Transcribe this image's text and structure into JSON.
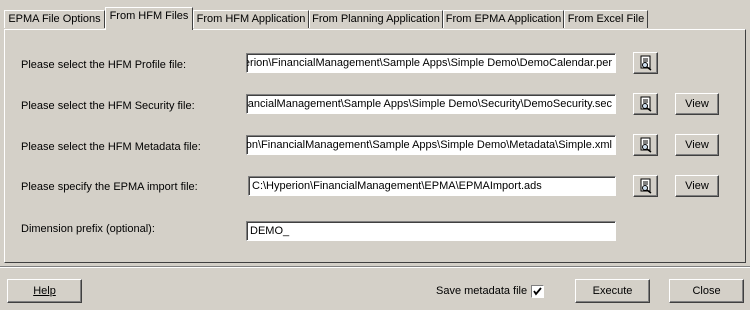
{
  "tabs": [
    {
      "label": "EPMA File Options"
    },
    {
      "label": "From HFM Files"
    },
    {
      "label": "From HFM Application"
    },
    {
      "label": "From Planning Application"
    },
    {
      "label": "From EPMA Application"
    },
    {
      "label": "From Excel File"
    }
  ],
  "active_tab": "From HFM Files",
  "form": {
    "profile": {
      "label": "Please select the HFM Profile file:",
      "value": "C:\\Hyperion\\FinancialManagement\\Sample Apps\\Simple Demo\\DemoCalendar.per"
    },
    "security": {
      "label": "Please select the HFM Security file:",
      "value": "C:\\Hyperion\\FinancialManagement\\Sample Apps\\Simple Demo\\Security\\DemoSecurity.sec",
      "view_label": "View"
    },
    "metadata": {
      "label": "Please select the HFM Metadata file:",
      "value": "C:\\Hyperion\\FinancialManagement\\Sample Apps\\Simple Demo\\Metadata\\Simple.xml",
      "view_label": "View"
    },
    "epma_import": {
      "label": "Please specify the EPMA import file:",
      "value": "C:\\Hyperion\\FinancialManagement\\EPMA\\EPMAImport.ads",
      "view_label": "View"
    },
    "prefix": {
      "label": "Dimension prefix (optional):",
      "value": "DEMO_"
    }
  },
  "footer": {
    "help_label": "Help",
    "save_metadata_label": "Save metadata file",
    "save_metadata_checked": true,
    "execute_label": "Execute",
    "close_label": "Close"
  },
  "icons": {
    "browse": "browse-file-icon",
    "checkmark": "checkmark-icon"
  }
}
